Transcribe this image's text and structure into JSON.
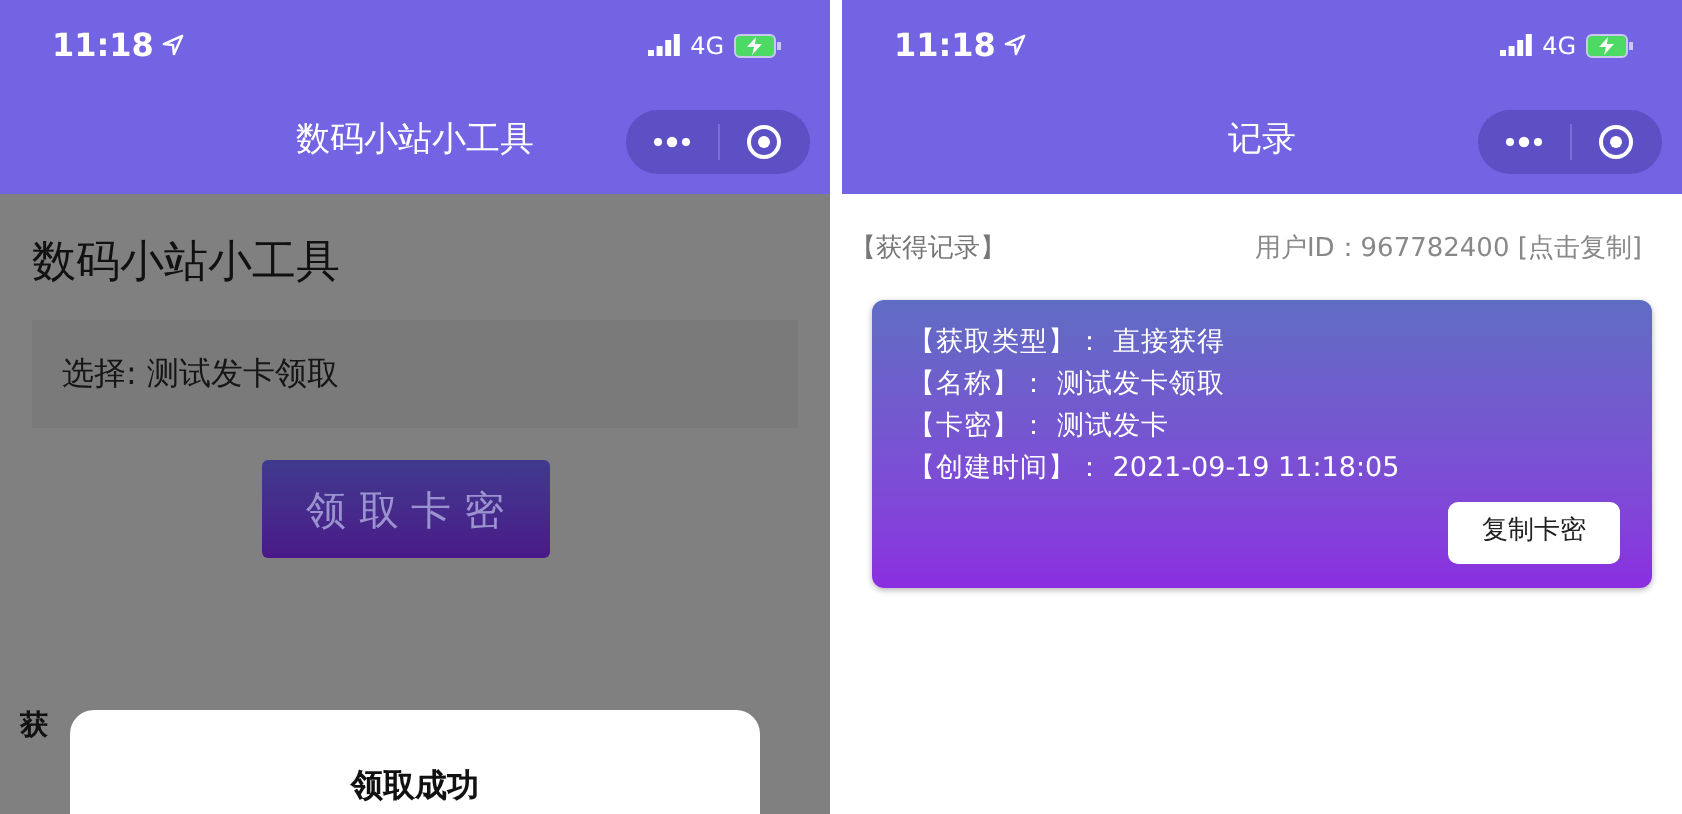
{
  "left_screen": {
    "status_bar": {
      "time": "11:18",
      "network": "4G"
    },
    "nav_title": "数码小站小工具",
    "page_title": "数码小站小工具",
    "selection": "选择: 测试发卡领取",
    "claim_button": "领 取 卡 密",
    "covered_label": "获",
    "dialog": {
      "title": "领取成功"
    }
  },
  "right_screen": {
    "status_bar": {
      "time": "11:18",
      "network": "4G"
    },
    "nav_title": "记录",
    "section_label": "【获得记录】",
    "user_id": "用户ID：967782400 [点击复制]",
    "record": {
      "lines": [
        {
          "label": "【获取类型】",
          "value": "： 直接获得"
        },
        {
          "label": "【名称】",
          "value": "： 测试发卡领取"
        },
        {
          "label": "【卡密】",
          "value": "： 测试发卡"
        },
        {
          "label": "【创建时间】",
          "value": "： 2021-09-19 11:18:05"
        }
      ],
      "copy_button": "复制卡密"
    }
  }
}
